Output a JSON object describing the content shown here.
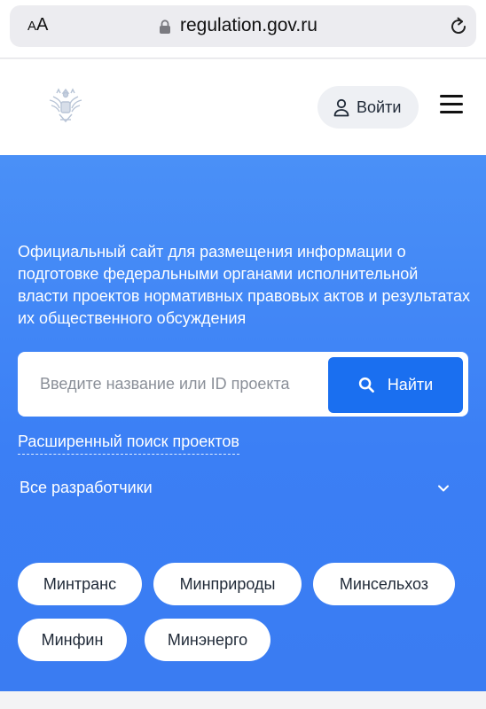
{
  "browser": {
    "aa_small": "A",
    "aa_large": "A",
    "url": "regulation.gov.ru",
    "icons": {
      "lock": "lock-icon",
      "reload": "reload-icon"
    }
  },
  "header": {
    "emblem_icon": "coat-of-arms-icon",
    "login_label": "Войти",
    "login_icon": "user-icon",
    "menu_icon": "hamburger-menu-icon"
  },
  "hero": {
    "description": "Официальный сайт для размещения информации о подготовке федеральными органами исполнительной власти проектов нормативных правовых актов и результатах их общественного обсуждения",
    "search": {
      "placeholder": "Введите название или ID проекта",
      "button_label": "Найти",
      "button_icon": "search-icon"
    },
    "advanced_search": "Расширенный поиск проектов",
    "developers_select": {
      "selected": "Все разработчики",
      "icon": "chevron-down-icon"
    },
    "chips": [
      "Минтранс",
      "Минприроды",
      "Минсельхоз",
      "Минфин",
      "Минэнерго"
    ]
  },
  "colors": {
    "hero_top": "#4a90f7",
    "hero_bottom": "#3a7cf2",
    "button_blue": "#1a6ff0",
    "address_bar": "#ececf0"
  }
}
